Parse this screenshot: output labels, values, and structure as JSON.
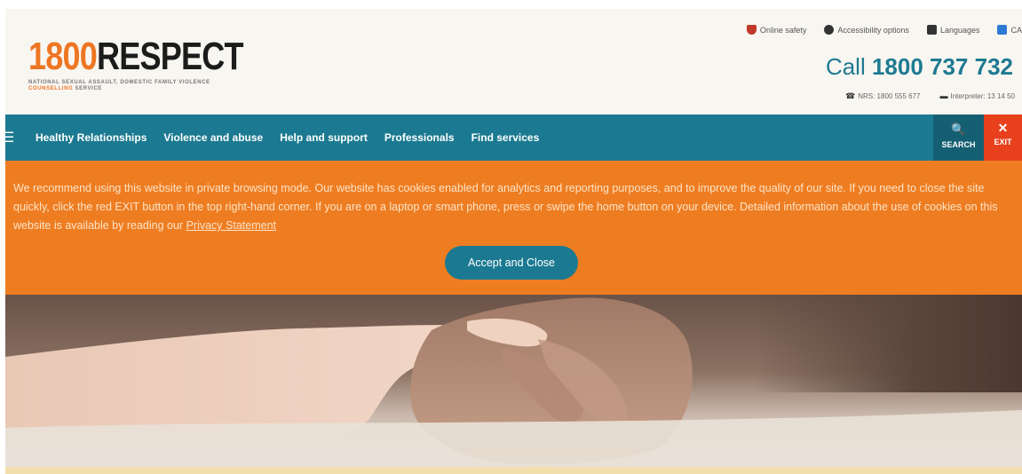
{
  "header": {
    "logo": {
      "number": "1800",
      "word": "RESPECT",
      "tagline_pre": "NATIONAL SEXUAL ASSAULT, DOMESTIC FAMILY VIOLENCE ",
      "tagline_highlight": "COUNSELLING",
      "tagline_post": " SERVICE"
    },
    "utility_links": [
      {
        "label": "Online safety",
        "icon": "shield-icon"
      },
      {
        "label": "Accessibility options",
        "icon": "accessibility-icon"
      },
      {
        "label": "Languages",
        "icon": "language-icon"
      },
      {
        "label": "CA",
        "icon": "ca-icon"
      }
    ],
    "call_prefix": "Call ",
    "call_number": "1800 737 732",
    "contact": {
      "nrs": "NRS: 1800 555 677",
      "interpreter": "Interpreter: 13 14 50"
    }
  },
  "nav": {
    "menu_icon": "☰",
    "items": [
      "Healthy Relationships",
      "Violence and abuse",
      "Help and support",
      "Professionals",
      "Find services"
    ],
    "search_label": "SEARCH",
    "exit_label": "EXIT",
    "search_icon": "🔍",
    "exit_icon": "✕"
  },
  "cookie": {
    "text": "We recommend using this website in private browsing mode. Our website has cookies enabled for analytics and reporting purposes, and to improve the quality of our site. If you need to close the site quickly, click the red EXIT button in the top right-hand corner. If you are on a laptop or smart phone, press or swipe the home button on your device. Detailed information about the use of cookies on this website is available by reading our ",
    "link_text": "Privacy Statement",
    "accept_label": "Accept and Close"
  },
  "colors": {
    "brand_orange": "#ee7623",
    "nav_teal": "#1b7a91",
    "exit_red": "#e8401c",
    "banner_orange": "#ee7d22"
  }
}
